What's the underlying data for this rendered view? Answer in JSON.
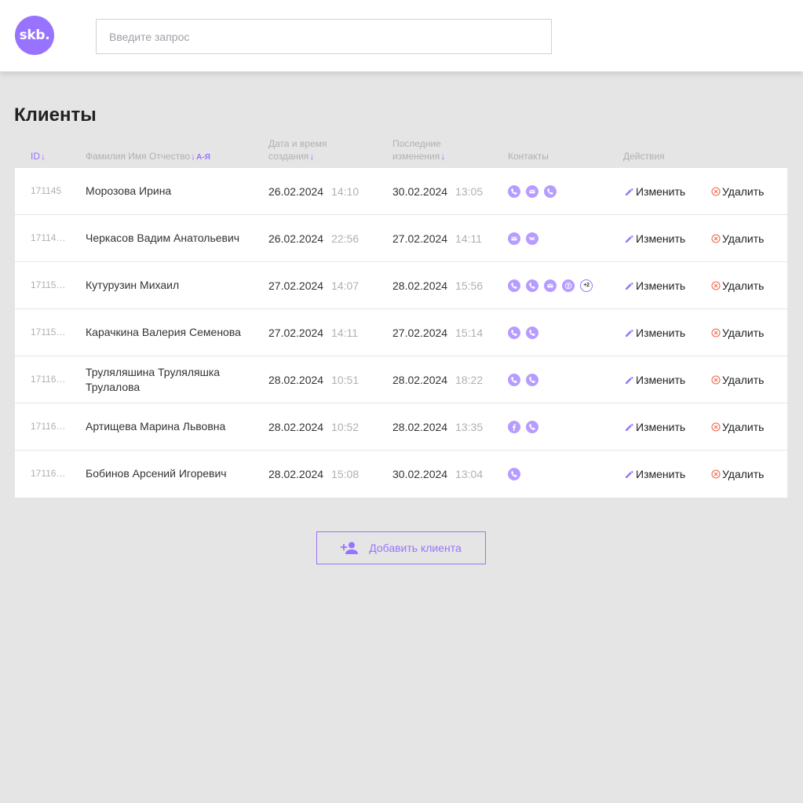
{
  "header": {
    "logo_text": "skb.",
    "search_placeholder": "Введите запрос"
  },
  "page_title": "Клиенты",
  "columns": {
    "id": "ID",
    "name": "Фамилия Имя Отчество",
    "name_sort": "А-Я",
    "created_line1": "Дата и время",
    "created_line2": "создания",
    "modified_line1": "Последние",
    "modified_line2": "изменения",
    "contacts": "Контакты",
    "actions": "Действия"
  },
  "actions": {
    "edit": "Изменить",
    "delete": "Удалить"
  },
  "clients": [
    {
      "id": "171145",
      "name": "Морозова Ирина",
      "created_date": "26.02.2024",
      "created_time": "14:10",
      "modified_date": "30.02.2024",
      "modified_time": "13:05",
      "contacts": [
        "phone-icon",
        "mail-icon",
        "phone-icon"
      ]
    },
    {
      "id": "17114…",
      "name": "Черкасов Вадим Анатольевич",
      "created_date": "26.02.2024",
      "created_time": "22:56",
      "modified_date": "27.02.2024",
      "modified_time": "14:11",
      "contacts": [
        "mail-icon",
        "vk-icon"
      ]
    },
    {
      "id": "17115…",
      "name": "Кутурузин Михаил",
      "created_date": "27.02.2024",
      "created_time": "14:07",
      "modified_date": "28.02.2024",
      "modified_time": "15:56",
      "contacts": [
        "phone-icon",
        "phone-icon",
        "mail-icon",
        "user-icon",
        "+2"
      ]
    },
    {
      "id": "17115…",
      "name": "Карачкина Валерия Семенова",
      "created_date": "27.02.2024",
      "created_time": "14:11",
      "modified_date": "27.02.2024",
      "modified_time": "15:14",
      "contacts": [
        "phone-icon",
        "phone-icon"
      ]
    },
    {
      "id": "17116…",
      "name": "Труляляшина Труляляшка Трулалова",
      "created_date": "28.02.2024",
      "created_time": "10:51",
      "modified_date": "28.02.2024",
      "modified_time": "18:22",
      "contacts": [
        "phone-icon",
        "phone-icon"
      ]
    },
    {
      "id": "17116…",
      "name": "Артищева Марина Львовна",
      "created_date": "28.02.2024",
      "created_time": "10:52",
      "modified_date": "28.02.2024",
      "modified_time": "13:35",
      "contacts": [
        "facebook-icon",
        "phone-icon"
      ]
    },
    {
      "id": "17116…",
      "name": "Бобинов Арсений Игоревич",
      "created_date": "28.02.2024",
      "created_time": "15:08",
      "modified_date": "30.02.2024",
      "modified_time": "13:04",
      "contacts": [
        "phone-icon"
      ]
    }
  ],
  "add_button": "Добавить клиента",
  "colors": {
    "accent": "#9873ff",
    "icon_fill": "#b79cff",
    "delete": "#f06a4d",
    "background": "#e5e5e5"
  }
}
